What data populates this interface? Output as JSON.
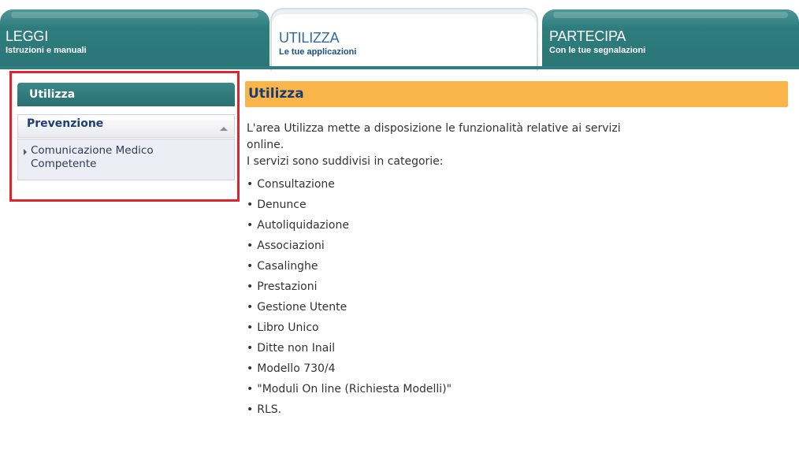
{
  "tabs": [
    {
      "title": "LEGGI",
      "subtitle": "Istruzioni e manuali"
    },
    {
      "title": "UTILIZZA",
      "subtitle": "Le tue applicazioni"
    },
    {
      "title": "PARTECIPA",
      "subtitle": "Con le tue segnalazioni"
    }
  ],
  "sidebar": {
    "header": "Utilizza",
    "category": "Prevenzione",
    "link_line1": "Comunicazione Medico",
    "link_line2": "Competente"
  },
  "main": {
    "title": "Utilizza",
    "intro_line1": "L'area Utilizza mette a disposizione le funzionalità relative ai servizi",
    "intro_line2": "online.",
    "intro_line3": "I servizi sono suddivisi in categorie:",
    "items": [
      "Consultazione",
      "Denunce",
      "Autoliquidazione",
      "Associazioni",
      "Casalinghe",
      "Prestazioni",
      "Gestione Utente",
      "Libro Unico",
      "Ditte non Inail",
      "Modello 730/4",
      "\"Moduli On line (Richiesta Modelli)\"",
      "RLS."
    ]
  },
  "colors": {
    "tab_teal": "#2f7d7e",
    "main_header": "#f9b44a",
    "highlight_frame": "#e0242f"
  }
}
